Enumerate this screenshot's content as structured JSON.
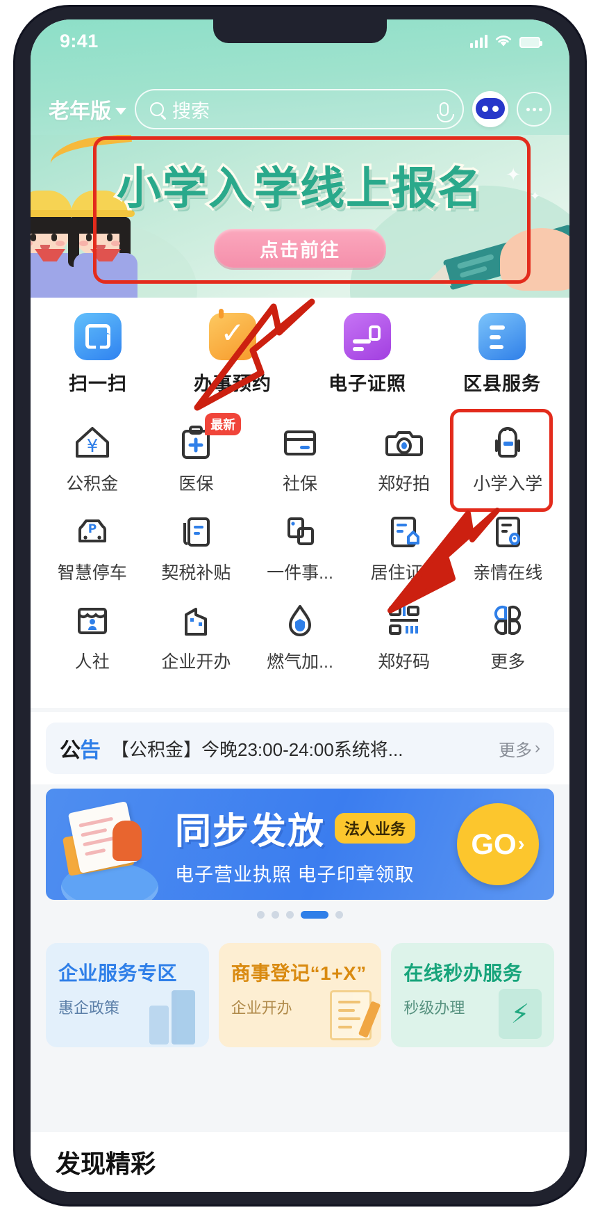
{
  "status_bar": {
    "time": "9:41",
    "signal_icon": "cellular-signal-icon",
    "wifi_icon": "wifi-icon",
    "battery_icon": "battery-icon"
  },
  "header": {
    "version_label": "老年版",
    "version_caret_icon": "chevron-down-icon",
    "search_placeholder": "搜索",
    "search_icon": "search-icon",
    "mic_icon": "microphone-icon",
    "assistant_icon": "robot-assistant-icon",
    "more_icon": "more-dots-icon"
  },
  "hero_banner": {
    "title": "小学入学线上报名",
    "button_label": "点击前往",
    "accent_color": "#2aa98b",
    "button_color": "#f58fab"
  },
  "quick_actions": [
    {
      "label": "扫一扫",
      "icon": "scan-qr-icon",
      "color": "#2f82f0"
    },
    {
      "label": "办事预约",
      "icon": "calendar-check-icon",
      "color": "#f79a2b"
    },
    {
      "label": "电子证照",
      "icon": "id-card-icon",
      "color": "#a23fe0"
    },
    {
      "label": "区县服务",
      "icon": "district-service-icon",
      "color": "#2f7fe8"
    }
  ],
  "service_grid": [
    {
      "label": "公积金",
      "icon": "house-yuan-icon",
      "badge": ""
    },
    {
      "label": "医保",
      "icon": "medical-clipboard-icon",
      "badge": "最新"
    },
    {
      "label": "社保",
      "icon": "social-security-card-icon",
      "badge": ""
    },
    {
      "label": "郑好拍",
      "icon": "camera-icon",
      "badge": ""
    },
    {
      "label": "小学入学",
      "icon": "school-backpack-icon",
      "badge": ""
    },
    {
      "label": "智慧停车",
      "icon": "parking-car-icon",
      "badge": ""
    },
    {
      "label": "契税补贴",
      "icon": "tax-document-icon",
      "badge": ""
    },
    {
      "label": "一件事...",
      "icon": "stacked-pages-icon",
      "badge": ""
    },
    {
      "label": "居住证...",
      "icon": "residence-permit-icon",
      "badge": ""
    },
    {
      "label": "亲情在线",
      "icon": "family-online-icon",
      "badge": ""
    },
    {
      "label": "人社",
      "icon": "human-resources-icon",
      "badge": ""
    },
    {
      "label": "企业开办",
      "icon": "company-building-icon",
      "badge": ""
    },
    {
      "label": "燃气加...",
      "icon": "gas-flame-icon",
      "badge": ""
    },
    {
      "label": "郑好码",
      "icon": "qr-code-icon",
      "badge": ""
    },
    {
      "label": "更多",
      "icon": "more-grid-icon",
      "badge": ""
    }
  ],
  "notice": {
    "tag": "公告",
    "text": "【公积金】今晚23:00-24:00系统将...",
    "more_label": "更多",
    "more_icon": "chevron-right-icon"
  },
  "promo": {
    "title": "同步发放",
    "badge": "法人业务",
    "subtitle": "电子营业执照 电子印章领取",
    "go_label": "GO",
    "bg_color": "#3b7def",
    "go_color": "#fcc62d"
  },
  "carousel": {
    "total_dots": 5,
    "active_index": 3
  },
  "bottom_cards": [
    {
      "title": "企业服务专区",
      "subtitle": "惠企政策",
      "bg": "#e3f0fb",
      "art": "buildings-icon"
    },
    {
      "title": "商事登记“1+X”",
      "subtitle": "企业开办",
      "bg": "#fdeed2",
      "art": "form-pen-icon"
    },
    {
      "title": "在线秒办服务",
      "subtitle": "秒级办理",
      "bg": "#ddf3ea",
      "art": "lightning-icon"
    }
  ],
  "footer_peek": {
    "text": "发现精彩"
  },
  "annotations": {
    "highlight_color": "#e32b1c",
    "boxes": [
      "hero-banner-highlight",
      "xiaoxue-ruxue-cell-highlight"
    ],
    "arrows": [
      "arrow-to-hero-banner",
      "arrow-to-xiaoxue-ruxue-cell"
    ]
  }
}
